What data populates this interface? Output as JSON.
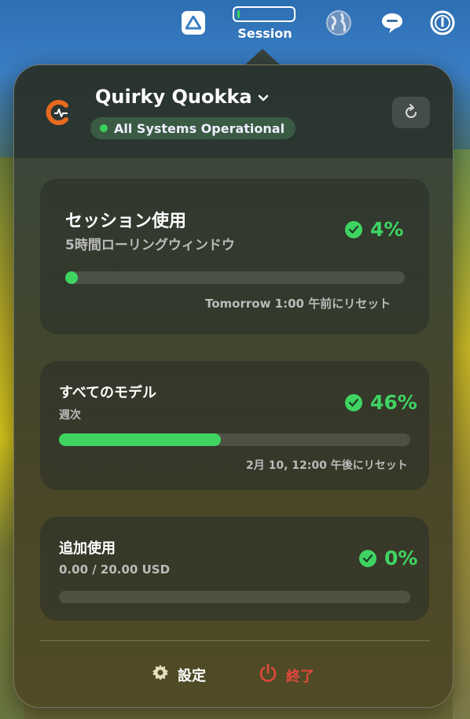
{
  "menubar": {
    "session_label": "Session",
    "session_fill_fraction": 0.04
  },
  "header": {
    "app_name": "Quirky Quokka",
    "status": "All Systems Operational",
    "status_color": "#39d05a"
  },
  "cards": [
    {
      "title": "セッション使用",
      "subtitle": "5時間ローリングウィンドウ",
      "percent": "4%",
      "fraction": 0.04,
      "reset": "Tomorrow 1:00 午前にリセット"
    },
    {
      "title": "すべてのモデル",
      "subtitle": "週次",
      "percent": "46%",
      "fraction": 0.46,
      "reset": "2月 10, 12:00 午後にリセット"
    },
    {
      "title": "追加使用",
      "subtitle": "0.00 / 20.00 USD",
      "percent": "0%",
      "fraction": 0.0
    }
  ],
  "footer": {
    "settings_label": "設定",
    "quit_label": "終了",
    "quit_color": "#e4493c"
  },
  "icons": [
    "google-drive-icon",
    "globe-icon",
    "chat-bubble-icon",
    "power-circle-icon",
    "app-logo-icon",
    "chevron-down-icon",
    "refresh-icon",
    "check-circle-icon",
    "gear-icon",
    "power-icon"
  ]
}
